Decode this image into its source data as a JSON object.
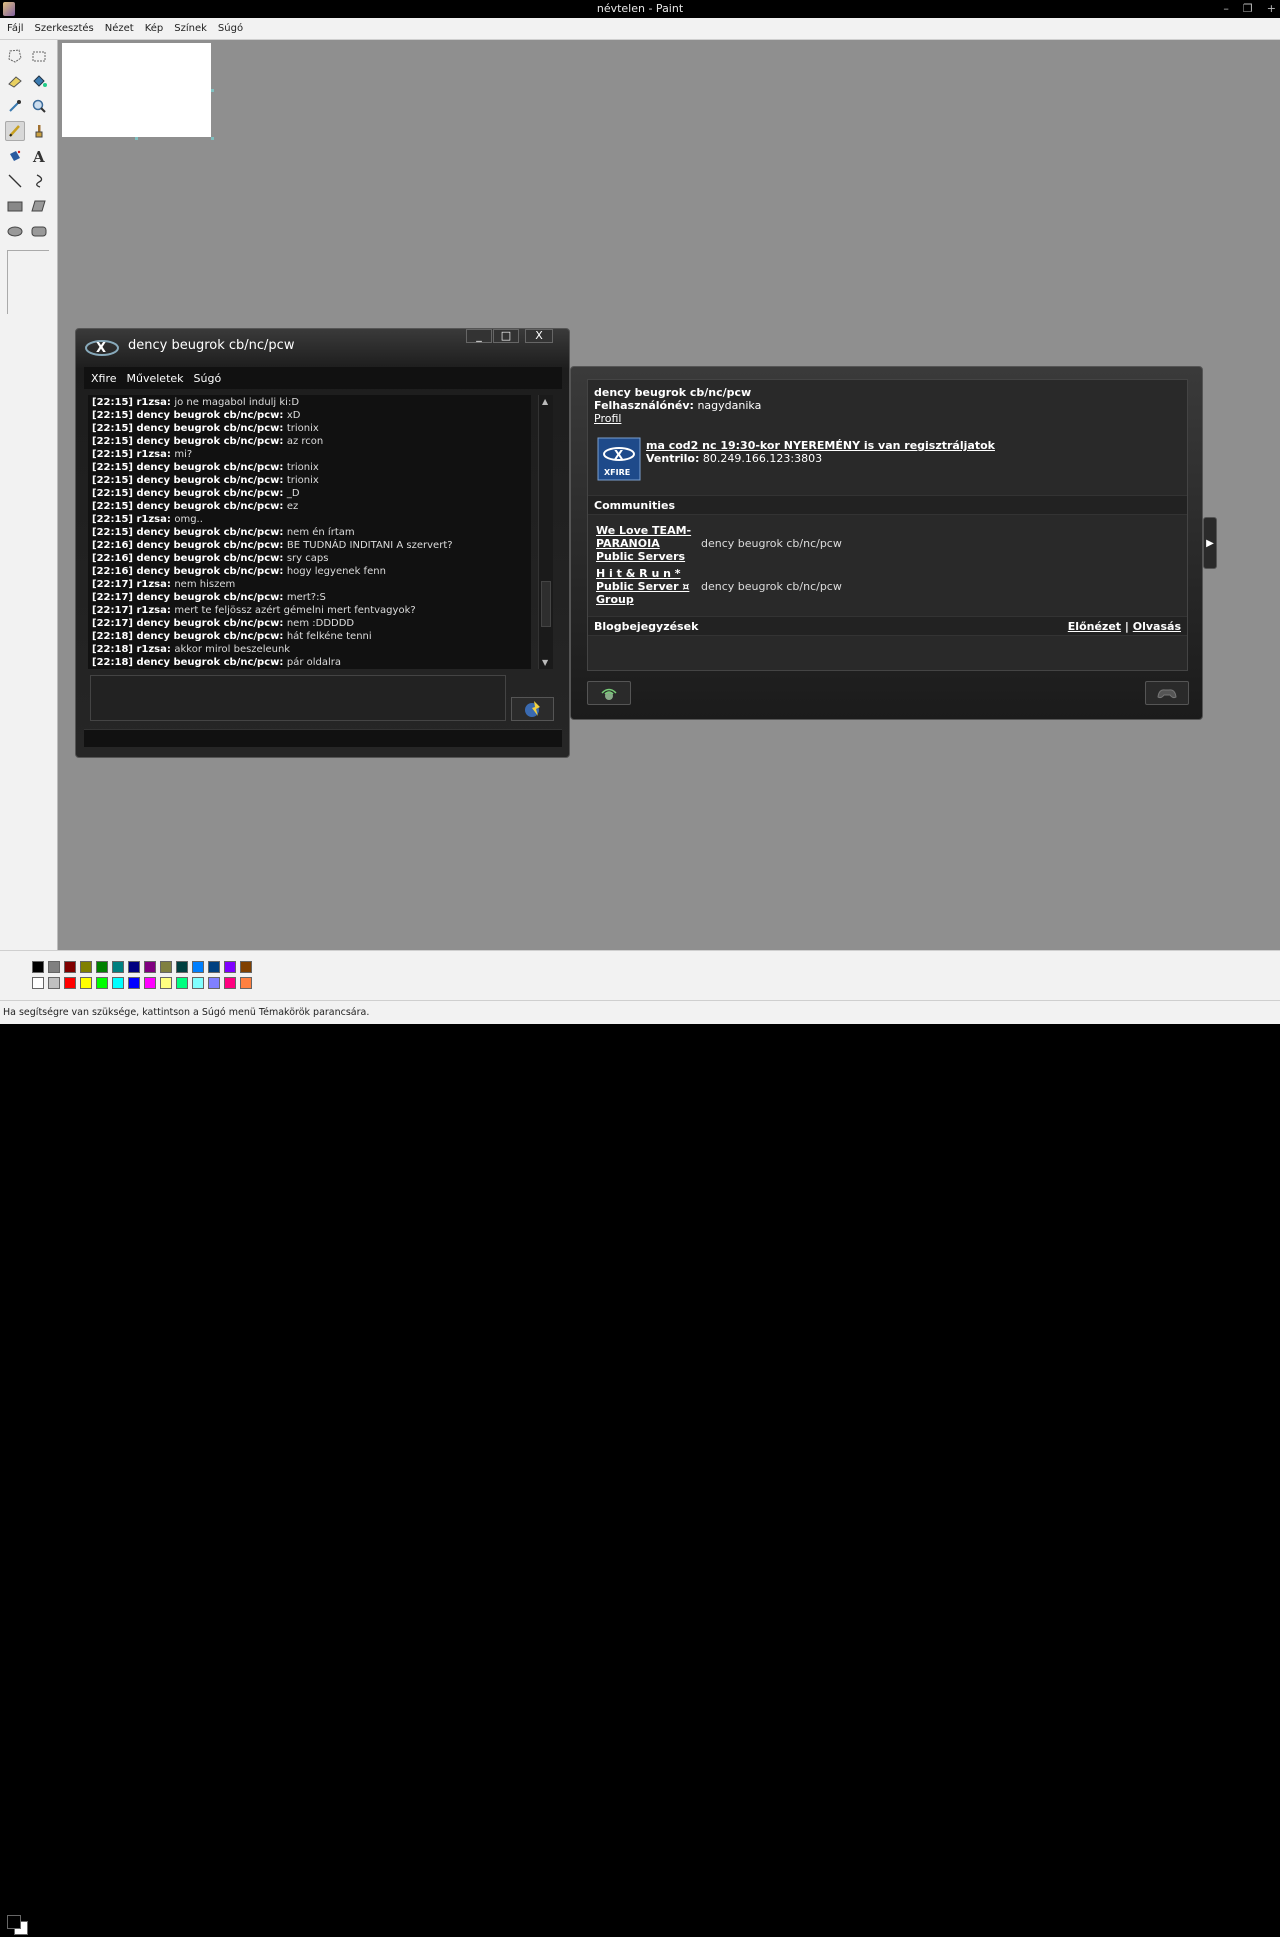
{
  "window": {
    "title": "névtelen - Paint",
    "controls": [
      "–",
      "❐",
      "+"
    ]
  },
  "menu": [
    "Fájl",
    "Szerkesztés",
    "Nézet",
    "Kép",
    "Színek",
    "Súgó"
  ],
  "tools": [
    "free-select-icon",
    "rect-select-icon",
    "eraser-icon",
    "fill-icon",
    "eyedropper-icon",
    "magnifier-icon",
    "pencil-icon",
    "brush-icon",
    "airbrush-icon",
    "text-icon",
    "line-icon",
    "curve-icon",
    "rectangle-icon",
    "polygon-icon",
    "ellipse-icon",
    "rounded-rect-icon"
  ],
  "palette": {
    "top": [
      "#000000",
      "#808080",
      "#800000",
      "#808000",
      "#008000",
      "#008080",
      "#000080",
      "#800080",
      "#808040",
      "#004040",
      "#0080ff",
      "#004080",
      "#8000ff",
      "#804000"
    ],
    "bottom": [
      "#ffffff",
      "#c0c0c0",
      "#ff0000",
      "#ffff00",
      "#00ff00",
      "#00ffff",
      "#0000ff",
      "#ff00ff",
      "#ffff80",
      "#00ff80",
      "#80ffff",
      "#8080ff",
      "#ff0080",
      "#ff8040"
    ],
    "fg": "#000000",
    "bg": "#ffffff"
  },
  "status": "Ha segítségre van szüksége, kattintson a Súgó menü Témakörök parancsára.",
  "chat": {
    "title": "dency beugrok cb/nc/pcw",
    "menu": [
      "Xfire",
      "Műveletek",
      "Súgó"
    ],
    "close": "X",
    "messages": [
      {
        "t": "[22:15]",
        "u": "r1zsa:",
        "m": "jo ne magabol indulj ki:D"
      },
      {
        "t": "[22:15]",
        "u": "dency beugrok cb/nc/pcw:",
        "m": "xD"
      },
      {
        "t": "[22:15]",
        "u": "dency beugrok cb/nc/pcw:",
        "m": "trionix"
      },
      {
        "t": "[22:15]",
        "u": "dency beugrok cb/nc/pcw:",
        "m": "az rcon"
      },
      {
        "t": "[22:15]",
        "u": "r1zsa:",
        "m": "mi?"
      },
      {
        "t": "[22:15]",
        "u": "dency beugrok cb/nc/pcw:",
        "m": "trionix"
      },
      {
        "t": "[22:15]",
        "u": "dency beugrok cb/nc/pcw:",
        "m": "trionix"
      },
      {
        "t": "[22:15]",
        "u": "dency beugrok cb/nc/pcw:",
        "m": "_D"
      },
      {
        "t": "[22:15]",
        "u": "dency beugrok cb/nc/pcw:",
        "m": "ez"
      },
      {
        "t": "[22:15]",
        "u": "r1zsa:",
        "m": "omg.."
      },
      {
        "t": "[22:15]",
        "u": "dency beugrok cb/nc/pcw:",
        "m": "nem én írtam"
      },
      {
        "t": "[22:16]",
        "u": "dency beugrok cb/nc/pcw:",
        "m": "BE TUDNÁD INDITANI A szervert?"
      },
      {
        "t": "[22:16]",
        "u": "dency beugrok cb/nc/pcw:",
        "m": "sry caps"
      },
      {
        "t": "[22:16]",
        "u": "dency beugrok cb/nc/pcw:",
        "m": "hogy legyenek fenn"
      },
      {
        "t": "[22:17]",
        "u": "r1zsa:",
        "m": "nem hiszem"
      },
      {
        "t": "[22:17]",
        "u": "dency beugrok cb/nc/pcw:",
        "m": "mert?:S"
      },
      {
        "t": "[22:17]",
        "u": "r1zsa:",
        "m": "mert te feljössz azért gémelni mert fentvagyok?"
      },
      {
        "t": "[22:17]",
        "u": "dency beugrok cb/nc/pcw:",
        "m": "nem :DDDDD"
      },
      {
        "t": "[22:18]",
        "u": "dency beugrok cb/nc/pcw:",
        "m": "hát felkéne tenni"
      },
      {
        "t": "[22:18]",
        "u": "r1zsa:",
        "m": "akkor mirol beszeleunk"
      },
      {
        "t": "[22:18]",
        "u": "dency beugrok cb/nc/pcw:",
        "m": "pár oldalra"
      }
    ]
  },
  "profile": {
    "name": "dency beugrok cb/nc/pcw",
    "user_label": "Felhasználónév:",
    "user_value": "nagydanika",
    "profile_link": "Profil",
    "status_link": "ma cod2 nc 19:30-kor NYEREMÉNY is van regisztráljatok",
    "ventrilo_label": "Ventrilo:",
    "ventrilo_value": "80.249.166.123:3803",
    "game_logo_text": "XFIRE",
    "communities_title": "Communities",
    "communities": [
      {
        "l1": "We Love TEAM-",
        "l2": "PARANOIA",
        "l3": "Public Servers",
        "member": "dency beugrok cb/nc/pcw"
      },
      {
        "l1": "H i t & R u n *",
        "l2": "Public Server ¤",
        "l3": "Group",
        "member": "dency beugrok cb/nc/pcw"
      }
    ],
    "blog_title": "Blogbejegyzések",
    "blog_preview": "Előnézet",
    "blog_sep": "|",
    "blog_read": "Olvasás"
  }
}
